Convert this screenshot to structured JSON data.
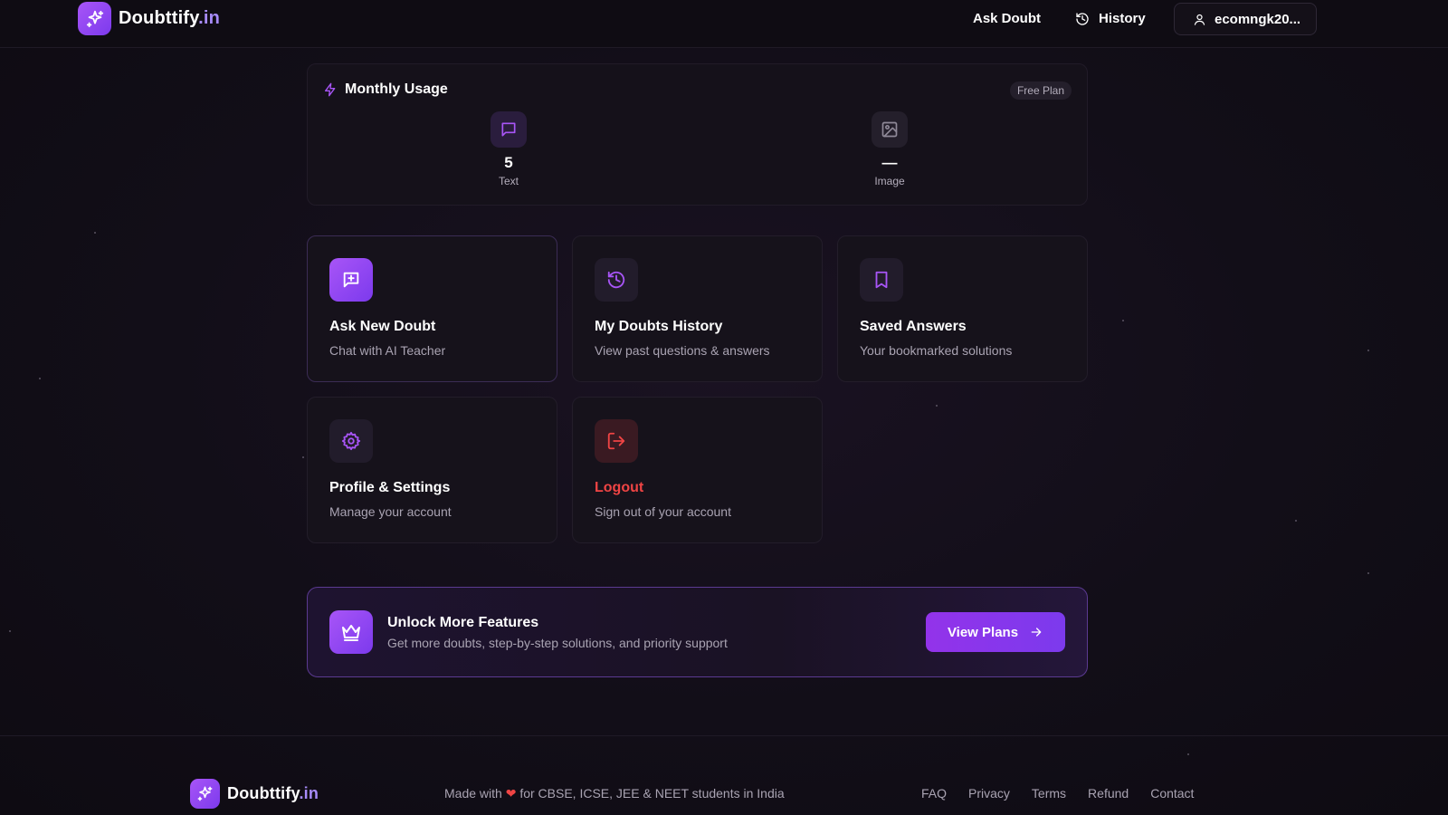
{
  "header": {
    "brand_main": "Doubttify",
    "brand_tld": ".in",
    "nav_ask": "Ask Doubt",
    "nav_history": "History",
    "user_label": "ecomngk20..."
  },
  "usage": {
    "title": "Monthly Usage",
    "plan": "Free Plan",
    "items": [
      {
        "label": "Text",
        "value": "5",
        "icon": "message-square-icon"
      },
      {
        "label": "Image",
        "value": "—",
        "icon": "image-icon"
      }
    ]
  },
  "cards": [
    {
      "title": "Ask New Doubt",
      "subtitle": "Chat with AI Teacher",
      "icon": "message-plus-icon"
    },
    {
      "title": "My Doubts History",
      "subtitle": "View past questions & answers",
      "icon": "history-icon"
    },
    {
      "title": "Saved Answers",
      "subtitle": "Your bookmarked solutions",
      "icon": "bookmark-icon"
    },
    {
      "title": "Profile & Settings",
      "subtitle": "Manage your account",
      "icon": "gear-icon"
    },
    {
      "title": "Logout",
      "subtitle": "Sign out of your account",
      "icon": "logout-icon",
      "accent": "#ef4444"
    }
  ],
  "promo": {
    "title": "Unlock More Features",
    "subtitle": "Get more doubts, step-by-step solutions, and priority support",
    "button": "View Plans",
    "icon": "crown-icon"
  },
  "footer": {
    "brand_main": "Doubttify",
    "brand_tld": ".in",
    "made_prefix": "Made with",
    "made_suffix": "for CBSE, ICSE, JEE & NEET students in India",
    "links": [
      "FAQ",
      "Privacy",
      "Terms",
      "Refund",
      "Contact"
    ]
  },
  "colors": {
    "accent": "#a855f7",
    "accent_dark": "#7c3aed",
    "danger": "#ef4444",
    "background": "#120e18"
  }
}
